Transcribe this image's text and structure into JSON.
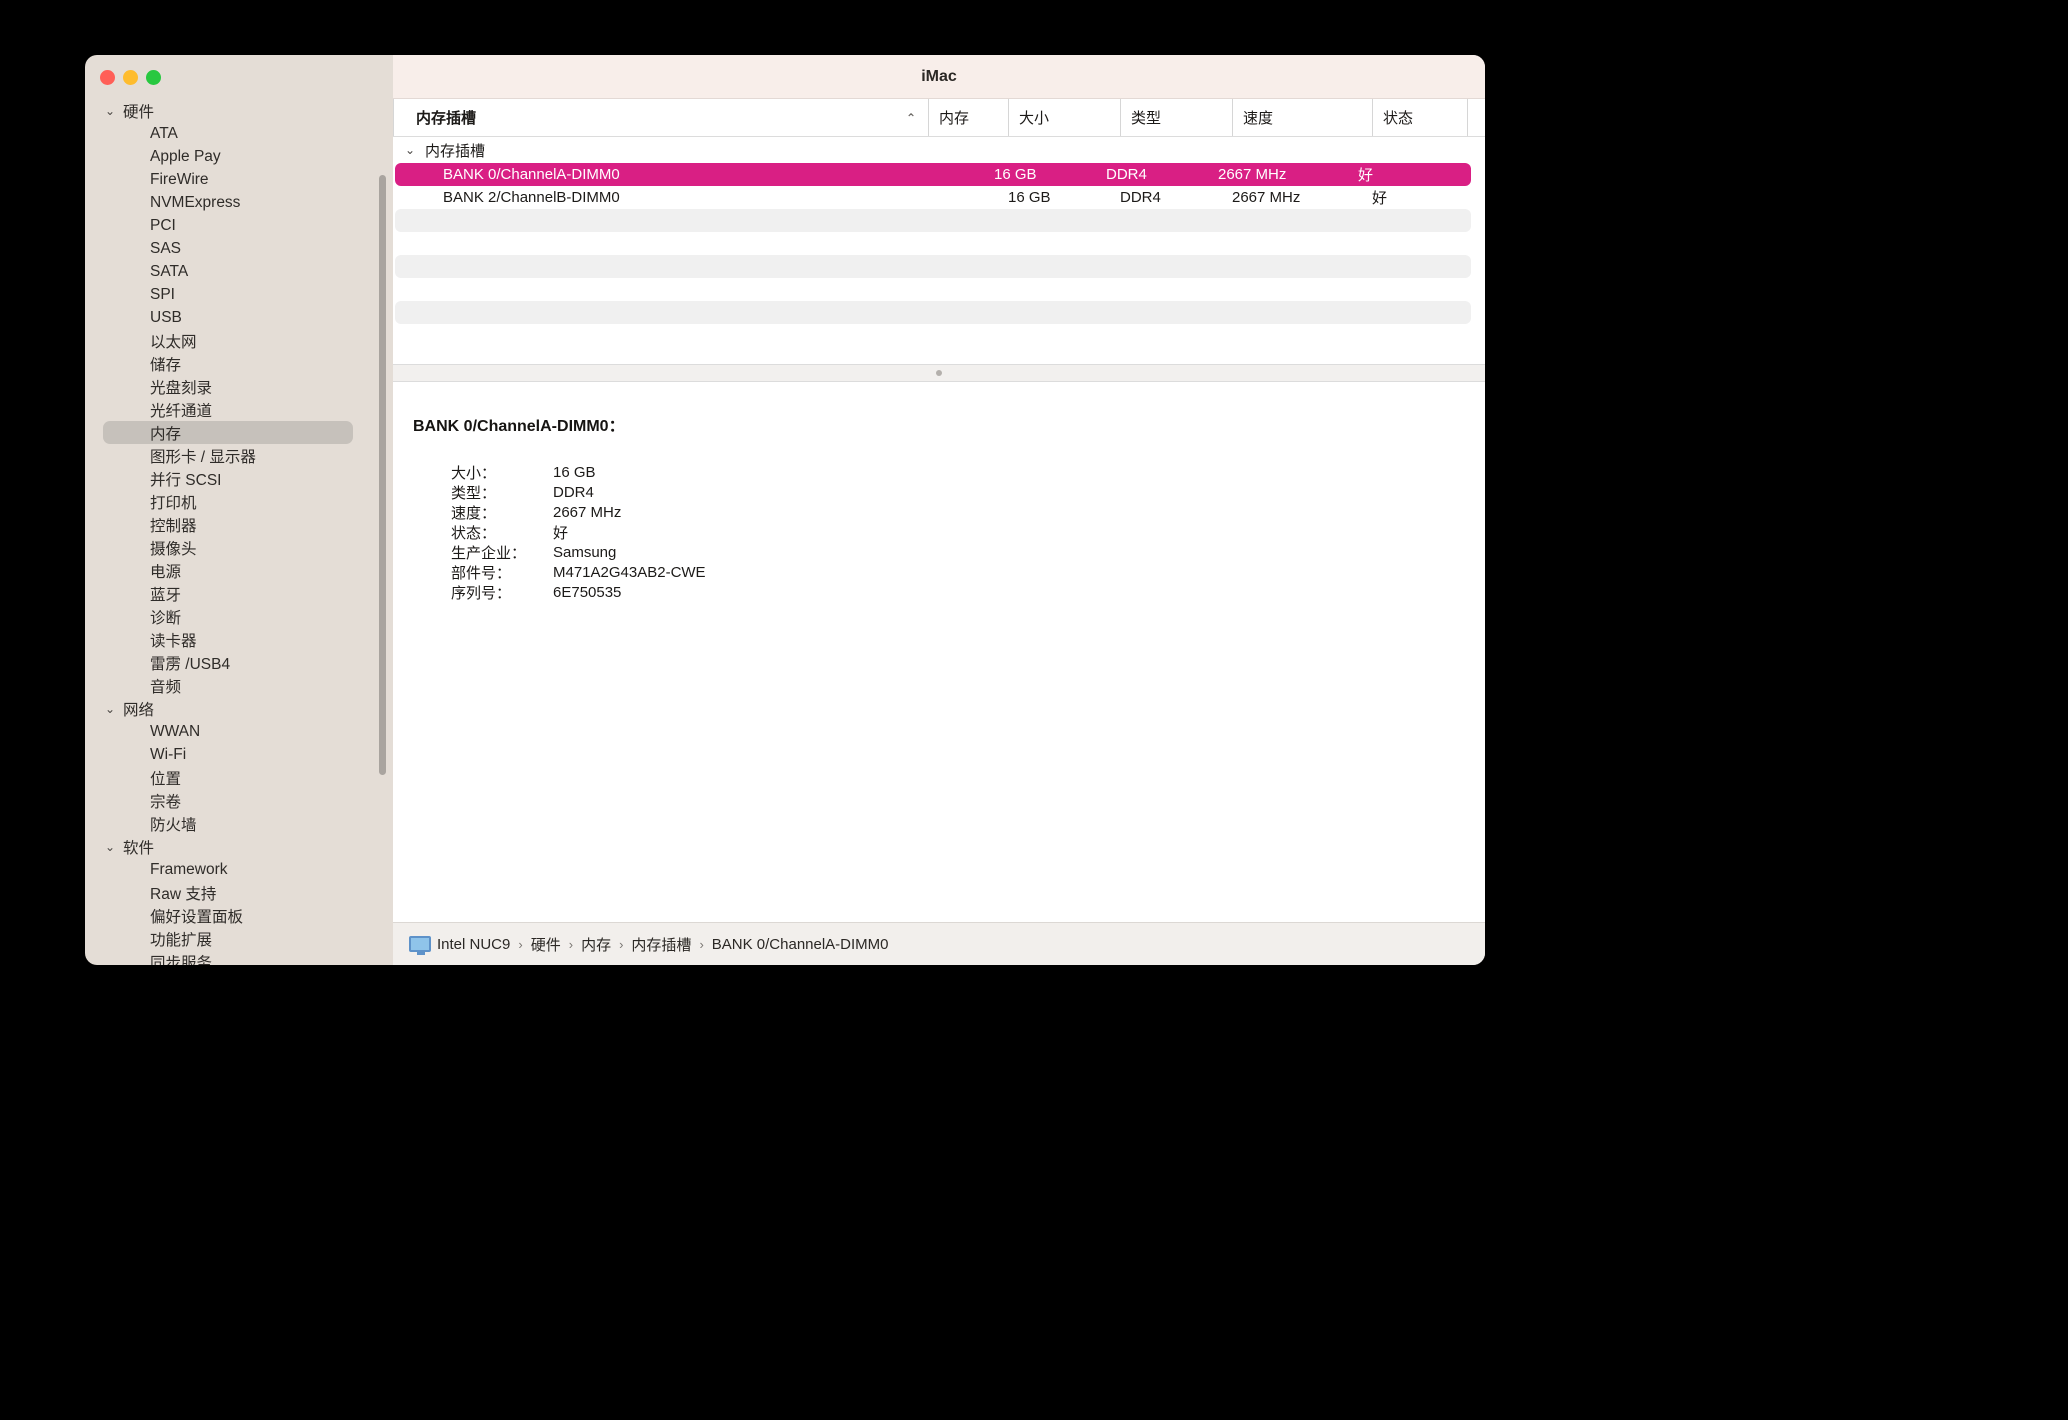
{
  "window": {
    "title": "iMac",
    "traffic_lights": [
      "close",
      "minimize",
      "maximize"
    ]
  },
  "sidebar": {
    "groups": [
      {
        "label": "硬件",
        "expanded": true,
        "items": [
          {
            "label": "ATA",
            "selected": false
          },
          {
            "label": "Apple Pay",
            "selected": false
          },
          {
            "label": "FireWire",
            "selected": false
          },
          {
            "label": "NVMExpress",
            "selected": false
          },
          {
            "label": "PCI",
            "selected": false
          },
          {
            "label": "SAS",
            "selected": false
          },
          {
            "label": "SATA",
            "selected": false
          },
          {
            "label": "SPI",
            "selected": false
          },
          {
            "label": "USB",
            "selected": false
          },
          {
            "label": "以太网",
            "selected": false
          },
          {
            "label": "储存",
            "selected": false
          },
          {
            "label": "光盘刻录",
            "selected": false
          },
          {
            "label": "光纤通道",
            "selected": false
          },
          {
            "label": "内存",
            "selected": true
          },
          {
            "label": "图形卡 / 显示器",
            "selected": false
          },
          {
            "label": "并行 SCSI",
            "selected": false
          },
          {
            "label": "打印机",
            "selected": false
          },
          {
            "label": "控制器",
            "selected": false
          },
          {
            "label": "摄像头",
            "selected": false
          },
          {
            "label": "电源",
            "selected": false
          },
          {
            "label": "蓝牙",
            "selected": false
          },
          {
            "label": "诊断",
            "selected": false
          },
          {
            "label": "读卡器",
            "selected": false
          },
          {
            "label": "雷雳 /USB4",
            "selected": false
          },
          {
            "label": "音频",
            "selected": false
          }
        ]
      },
      {
        "label": "网络",
        "expanded": true,
        "items": [
          {
            "label": "WWAN",
            "selected": false
          },
          {
            "label": "Wi-Fi",
            "selected": false
          },
          {
            "label": "位置",
            "selected": false
          },
          {
            "label": "宗卷",
            "selected": false
          },
          {
            "label": "防火墙",
            "selected": false
          }
        ]
      },
      {
        "label": "软件",
        "expanded": true,
        "items": [
          {
            "label": "Framework",
            "selected": false
          },
          {
            "label": "Raw 支持",
            "selected": false
          },
          {
            "label": "偏好设置面板",
            "selected": false
          },
          {
            "label": "功能扩展",
            "selected": false
          },
          {
            "label": "同步服务",
            "selected": false
          }
        ]
      }
    ]
  },
  "table": {
    "columns": [
      {
        "key": "name",
        "label": "内存插槽",
        "sort": "ascending",
        "sort_glyph": "⌃"
      },
      {
        "key": "mem",
        "label": "内存"
      },
      {
        "key": "size",
        "label": "大小"
      },
      {
        "key": "type",
        "label": "类型"
      },
      {
        "key": "speed",
        "label": "速度"
      },
      {
        "key": "state",
        "label": "状态"
      }
    ],
    "group_row": {
      "label": "内存插槽",
      "expanded": true,
      "disclosure_glyph": "⌄"
    },
    "rows": [
      {
        "name": "BANK 0/ChannelA-DIMM0",
        "mem": "",
        "size": "16 GB",
        "type": "DDR4",
        "speed": "2667 MHz",
        "state": "好",
        "selected": true
      },
      {
        "name": "BANK 2/ChannelB-DIMM0",
        "mem": "",
        "size": "16 GB",
        "type": "DDR4",
        "speed": "2667 MHz",
        "state": "好",
        "selected": false
      }
    ],
    "selection_color": "#d91f84"
  },
  "detail": {
    "title": "BANK 0/ChannelA-DIMM0：",
    "fields": [
      {
        "label": "大小：",
        "value": "16 GB"
      },
      {
        "label": "类型：",
        "value": "DDR4"
      },
      {
        "label": "速度：",
        "value": "2667 MHz"
      },
      {
        "label": "状态：",
        "value": "好"
      },
      {
        "label": "生产企业：",
        "value": "Samsung"
      },
      {
        "label": "部件号：",
        "value": "M471A2G43AB2-CWE"
      },
      {
        "label": "序列号：",
        "value": "6E750535"
      }
    ]
  },
  "breadcrumb": {
    "icon": "display-icon",
    "separator": "›",
    "items": [
      "Intel NUC9",
      "硬件",
      "内存",
      "内存插槽",
      "BANK 0/ChannelA-DIMM0"
    ]
  }
}
